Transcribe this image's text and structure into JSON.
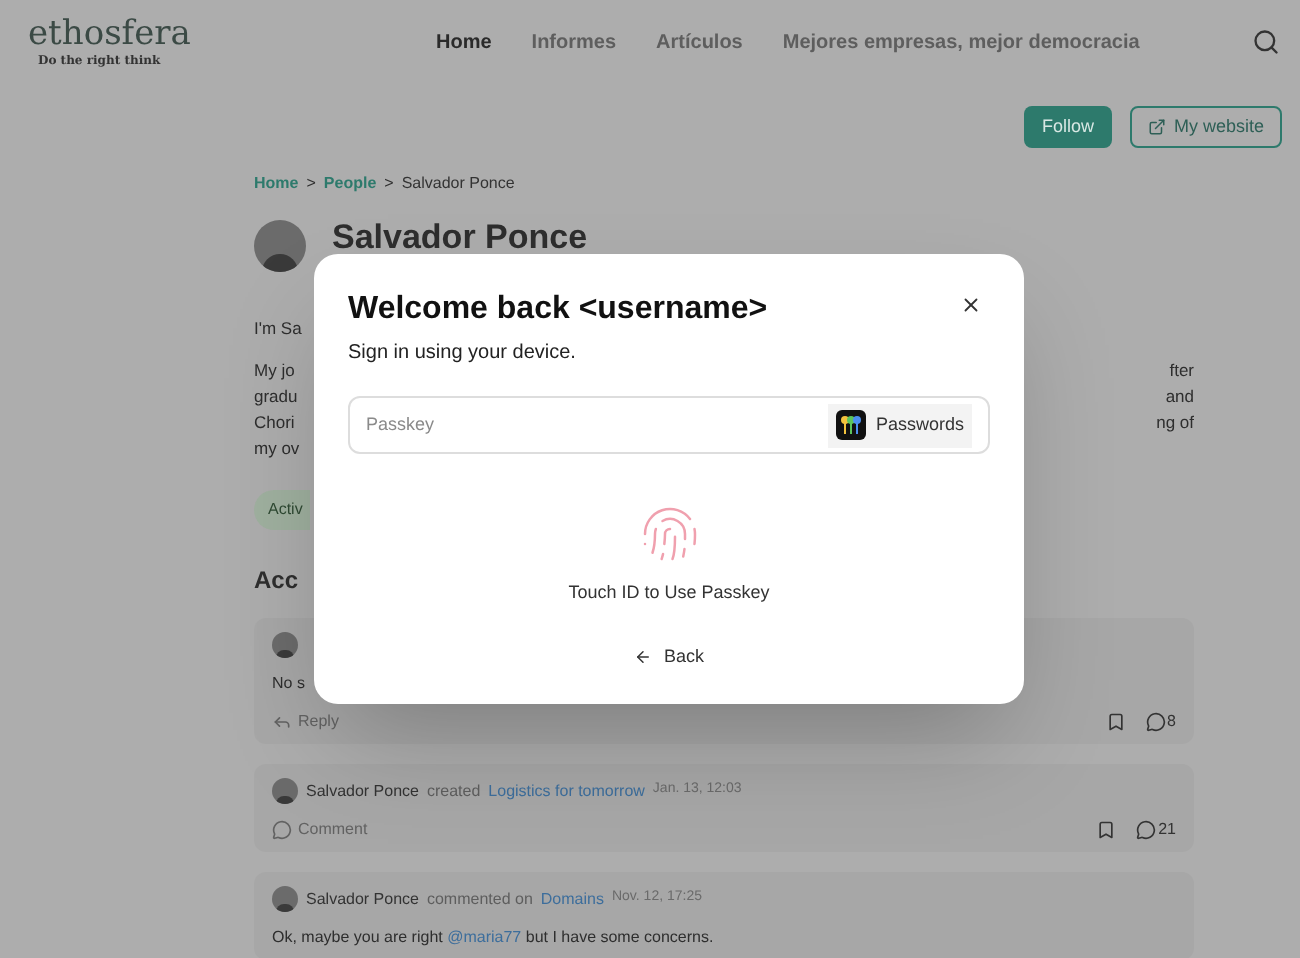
{
  "brand": {
    "name": "ethosfera",
    "tagline": "Do the right think"
  },
  "nav": [
    {
      "label": "Home",
      "selected": true
    },
    {
      "label": "Informes",
      "selected": false
    },
    {
      "label": "Artículos",
      "selected": false
    },
    {
      "label": "Mejores empresas, mejor democracia",
      "selected": false
    }
  ],
  "actions": {
    "follow": "Follow",
    "website": "My website"
  },
  "breadcrumb": [
    {
      "kind": "link",
      "label": "Home"
    },
    {
      "kind": "separator",
      "label": ">"
    },
    {
      "kind": "link",
      "label": "People"
    },
    {
      "kind": "separator",
      "label": ">"
    },
    {
      "kind": "current",
      "label": "Salvador Ponce"
    }
  ],
  "profile": {
    "name": "Salvador Ponce",
    "intro": "I'm Sa",
    "bio_lines": [
      {
        "left": "My jo",
        "right": "fter"
      },
      {
        "left": "gradu",
        "right": "and"
      },
      {
        "left": "Chori",
        "right": "ng of"
      },
      {
        "left": "my ov"
      }
    ],
    "badge": "Activ"
  },
  "section_title": "Acc",
  "activity": [
    {
      "kind": "hidden_header",
      "body": "No s",
      "action": "Reply",
      "count": "8"
    },
    {
      "kind": "created",
      "author": "Salvador Ponce",
      "verb": "created",
      "target": "Logistics for tomorrow",
      "time": "Jan. 13, 12:03",
      "action": "Comment",
      "count": "21"
    },
    {
      "kind": "commented",
      "author": "Salvador Ponce",
      "verb": "commented on",
      "target": "Domains",
      "time": "Nov. 12, 17:25",
      "body_before": "Ok, maybe you are right",
      "mention": "@maria77",
      "body_after": "but I have some concerns."
    }
  ],
  "dialog": {
    "title": "Welcome back <username>",
    "subtitle": "Sign in using your device.",
    "field": {
      "placeholder": "Passkey"
    },
    "passwords_button": "Passwords",
    "touch_id": "Touch ID to Use Passkey",
    "back": "Back"
  }
}
